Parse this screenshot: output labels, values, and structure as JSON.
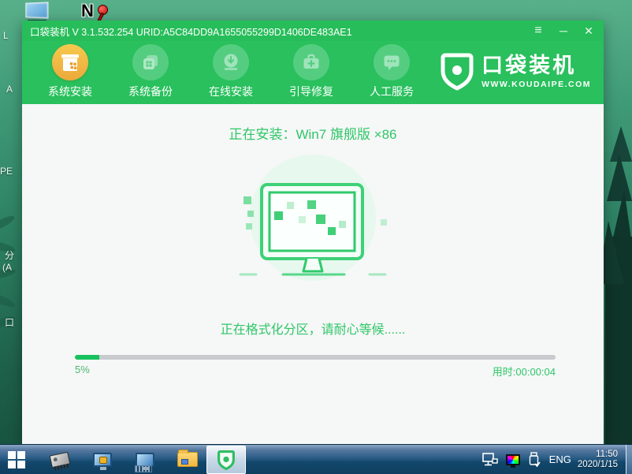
{
  "desktop": {
    "fragments": [
      "L",
      "A",
      "PE",
      "分",
      "(A",
      "口"
    ],
    "ntboot_letter": "N"
  },
  "titlebar": {
    "title": "口袋装机 V 3.1.532.254 URID:A5C84DD9A1655055299D1406DE483AE1",
    "menu_glyph": "≡",
    "minimize_glyph": "─",
    "close_glyph": "✕"
  },
  "toolbar": {
    "items": [
      {
        "label": "系统安装",
        "icon": "install-box-icon",
        "active": true
      },
      {
        "label": "系统备份",
        "icon": "backup-icon",
        "active": false
      },
      {
        "label": "在线安装",
        "icon": "download-icon",
        "active": false
      },
      {
        "label": "引导修复",
        "icon": "repair-kit-icon",
        "active": false
      },
      {
        "label": "人工服务",
        "icon": "chat-icon",
        "active": false
      }
    ],
    "logo_name": "口袋装机",
    "logo_site": "WWW.KOUDAIPE.COM"
  },
  "main": {
    "heading": "正在安装：Win7 旗舰版 ×86",
    "status": "正在格式化分区，请耐心等候......",
    "progress_percent_label": "5%",
    "progress_value": 5,
    "elapsed": "用时:00:00:04"
  },
  "taskbar": {
    "language": "ENG",
    "time": "11:50",
    "date": "2020/1/15"
  },
  "colors": {
    "brand_green": "#29c05d",
    "titlebar_green": "#27bd5a",
    "active_icon_yellow": "#efb83f",
    "inactive_circle_green": "#55cd80",
    "text_green": "#2ec767",
    "progress_fill": "#17c25e",
    "progress_track": "#c8cacd",
    "taskbar_blue": "#12476b",
    "desktop_teal": "#2b7d60"
  }
}
